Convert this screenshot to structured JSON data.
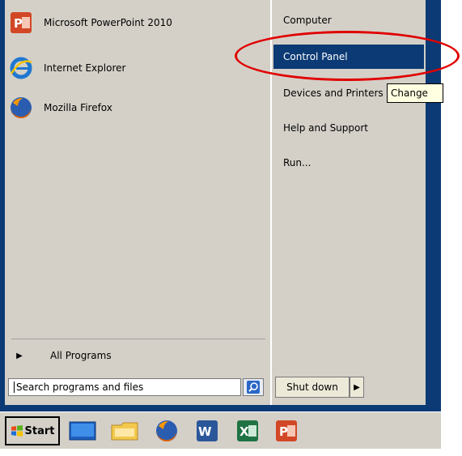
{
  "start_menu": {
    "pinned": [
      {
        "label": "Microsoft PowerPoint 2010",
        "icon": "powerpoint-icon"
      },
      {
        "label": "Internet Explorer",
        "icon": "internet-explorer-icon"
      },
      {
        "label": "Mozilla Firefox",
        "icon": "firefox-icon"
      }
    ],
    "all_programs": "All Programs",
    "search_placeholder": "Search programs and files",
    "right": [
      {
        "label": "Computer"
      },
      {
        "label": "Control Panel",
        "highlighted": true
      },
      {
        "label": "Devices and Printers"
      },
      {
        "label": "Help and Support"
      },
      {
        "label": "Run..."
      }
    ],
    "tooltip": "Change",
    "shutdown": "Shut down"
  },
  "taskbar": {
    "start_label": "Start",
    "icons": [
      "desktop-icon",
      "explorer-icon",
      "firefox-icon",
      "word-icon",
      "excel-icon",
      "powerpoint-icon"
    ]
  },
  "colors": {
    "accent": "#0b3a74",
    "annotation": "#e00000",
    "menu_bg": "#d4d0c8"
  }
}
